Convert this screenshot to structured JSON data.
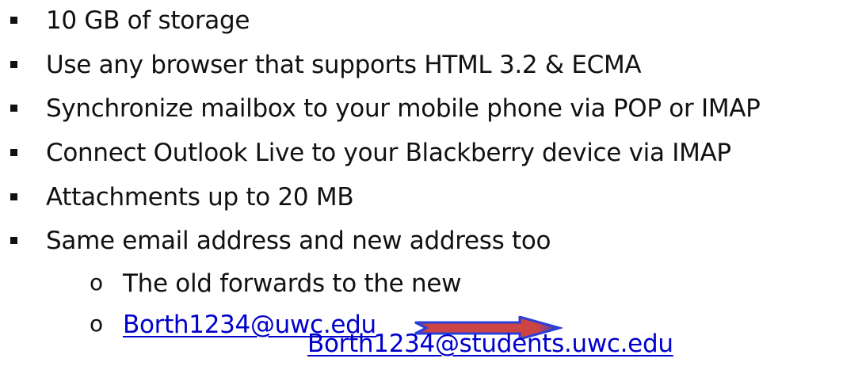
{
  "bullets": [
    {
      "text": "10 GB of storage"
    },
    {
      "text": "Use any browser that supports HTML 3.2 & ECMA"
    },
    {
      "text": "Synchronize mailbox to your mobile phone via POP or IMAP"
    },
    {
      "text": "Connect Outlook Live to your Blackberry device via IMAP"
    },
    {
      "text": "Attachments up to 20 MB"
    },
    {
      "text": "Same email address and new address too"
    }
  ],
  "sub_bullets": {
    "marker": "o",
    "item1": "The old forwards to the new",
    "old_address": "Borth1234@uwc.edu",
    "new_address": "Borth1234@students.uwc.edu"
  },
  "colors": {
    "text": "#111111",
    "link": "#0000cc",
    "arrow_fill": "#cc4444",
    "arrow_outline": "#2a3fd8"
  },
  "icons": {
    "arrow": "right-arrow-icon"
  }
}
